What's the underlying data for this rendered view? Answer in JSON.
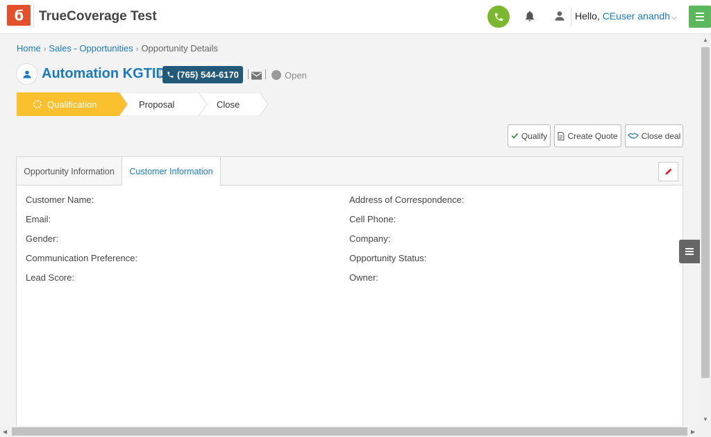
{
  "app": {
    "title": "TrueCoverage Test",
    "logo_glyph": "ϭ",
    "greeting": "Hello,",
    "user_name": "CEuser anandh",
    "user_caret": "⌵"
  },
  "colors": {
    "accent": "#1a7ac1",
    "brand": "#e2512c",
    "call": "#7cb82f",
    "menu": "#5cb85c",
    "active_stage": "#fbc02d",
    "phone_badge": "#235a7a"
  },
  "breadcrumb": {
    "items": [
      {
        "label": "Home"
      },
      {
        "label": "Sales - Opportunities"
      },
      {
        "label": "Opportunity Details"
      }
    ],
    "separator": "›"
  },
  "opportunity": {
    "name": "Automation KGTID",
    "phone": "(765) 544-6170",
    "status": "Open"
  },
  "stages": [
    {
      "label": "Qualification",
      "active": true
    },
    {
      "label": "Proposal",
      "active": false
    },
    {
      "label": "Close",
      "active": false
    }
  ],
  "actions": {
    "qualify": "Qualify",
    "create_quote": "Create Quote",
    "close_deal": "Close deal"
  },
  "tabs": {
    "opportunity_info": "Opportunity Information",
    "customer_info": "Customer Information",
    "active": "customer_info"
  },
  "customer_fields": {
    "left": [
      "Customer Name:",
      "Email:",
      "Gender:",
      "Communication Preference:",
      "Lead Score:"
    ],
    "right": [
      "Address of Correspondence:",
      "Cell Phone:",
      "Company:",
      "Opportunity Status:",
      "Owner:"
    ]
  },
  "icons": {
    "call": "phone-icon",
    "notifications": "bell-icon",
    "user": "user-icon",
    "menu": "hamburger-icon",
    "avatar": "person-icon",
    "mail": "envelope-icon",
    "qualify": "check-icon",
    "quote": "document-icon",
    "deal": "handshake-icon",
    "edit": "pencil-icon",
    "side_menu": "hamburger-icon"
  }
}
